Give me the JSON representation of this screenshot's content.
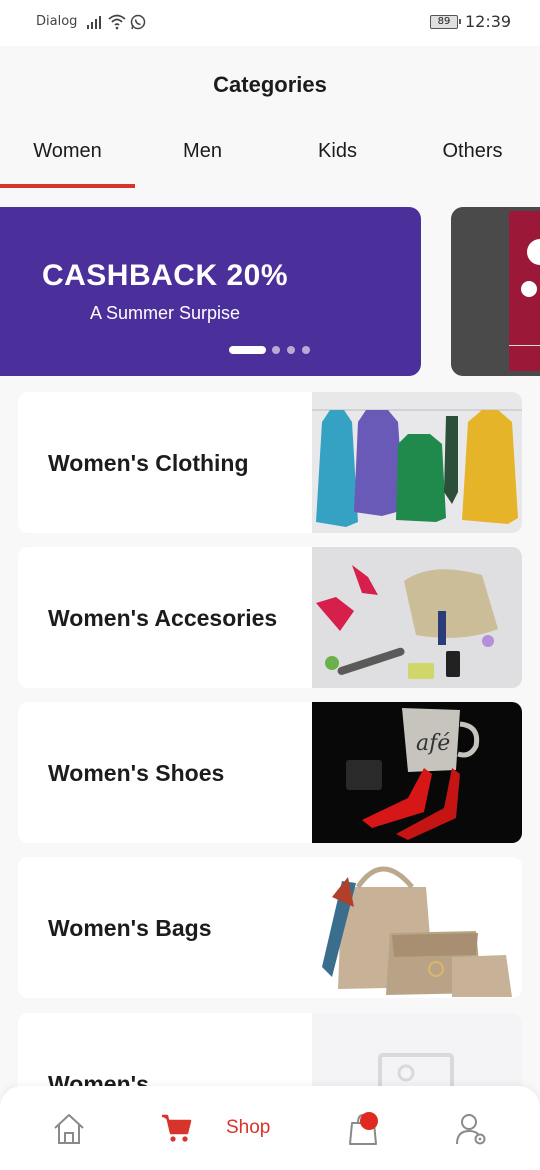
{
  "status_bar": {
    "carrier": "Dialog",
    "battery": "89",
    "time": "12:39",
    "icons": [
      "signal-icon",
      "wifi-icon",
      "whatsapp-icon",
      "battery-icon"
    ]
  },
  "page_title": "Categories",
  "tabs": [
    {
      "label": "Women",
      "active": true
    },
    {
      "label": "Men",
      "active": false
    },
    {
      "label": "Kids",
      "active": false
    },
    {
      "label": "Others",
      "active": false
    }
  ],
  "banner": {
    "headline": "CASHBACK 20%",
    "subtitle": "A Summer Surpise",
    "dots_total": 4,
    "active_index": 0
  },
  "categories": [
    {
      "label": "Women's Clothing",
      "image": "clothing-image"
    },
    {
      "label": "Women's Accesories",
      "image": "accessories-image"
    },
    {
      "label": "Women's Shoes",
      "image": "shoes-image"
    },
    {
      "label": "Women's Bags",
      "image": "bags-image"
    },
    {
      "label": "Women's",
      "image": "placeholder-image"
    }
  ],
  "bottom_nav": {
    "items": [
      "home-icon",
      "cart-icon",
      "bag-icon",
      "profile-settings-icon"
    ],
    "shop_label": "Shop",
    "active": "Shop"
  },
  "colors": {
    "accent": "#d9342b",
    "banner_bg": "#4b2f9a",
    "page_bg": "#f8f8f8"
  }
}
